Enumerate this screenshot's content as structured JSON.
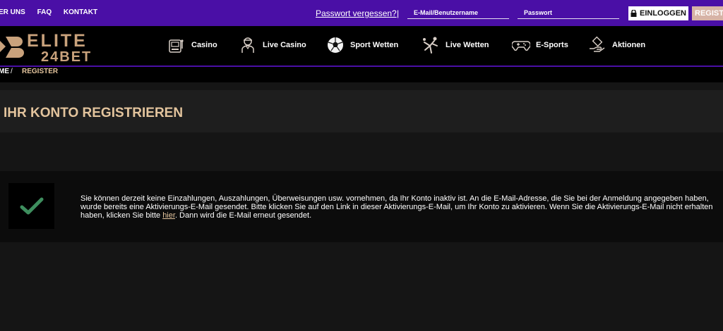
{
  "topbar": {
    "links": [
      "ER UNS",
      "FAQ",
      "KONTAKT"
    ],
    "forgot_password": "Passwort vergessen?",
    "separator": "|",
    "email_placeholder": "E-Mail/Benutzername",
    "password_placeholder": "Passwort",
    "login_label": "EINLOGGEN",
    "register_label": "REGISTRIEREN"
  },
  "logo": {
    "word": "ELITE",
    "sub": "24BET"
  },
  "nav": {
    "items": [
      {
        "label": "Casino",
        "icon": "slot-machine-icon"
      },
      {
        "label": "Live Casino",
        "icon": "dealer-icon"
      },
      {
        "label": "Sport Wetten",
        "icon": "soccer-ball-icon"
      },
      {
        "label": "Live Wetten",
        "icon": "kicker-icon"
      },
      {
        "label": "E-Sports",
        "icon": "gamepad-icon"
      },
      {
        "label": "Aktionen",
        "icon": "gift-hand-icon"
      }
    ]
  },
  "breadcrumb": {
    "home": "ME",
    "separator": "/",
    "current": "REGISTER"
  },
  "page": {
    "title": "IHR KONTO REGISTRIEREN"
  },
  "message": {
    "text_before": "Sie können derzeit keine Einzahlungen, Auszahlungen, Überweisungen usw. vornehmen, da Ihr Konto inaktiv ist. An die E-Mail-Adresse, die Sie bei der Anmeldung angegeben haben, wurde bereits eine Aktivierungs-E-Mail gesendet. Bitte klicken Sie auf den Link in dieser Aktivierungs-E-Mail, um Ihr Konto zu aktivieren. Wenn Sie die Aktivierungs-E-Mail nicht erhalten haben, klicken Sie bitte ",
    "link": "hier",
    "text_after": ". Dann wird die E-Mail erneut gesendet."
  },
  "colors": {
    "purple": "#4a0fa6",
    "gold": "#c9a27c",
    "title_gold": "#e3c49d",
    "check_green": "#3e8e5e"
  }
}
